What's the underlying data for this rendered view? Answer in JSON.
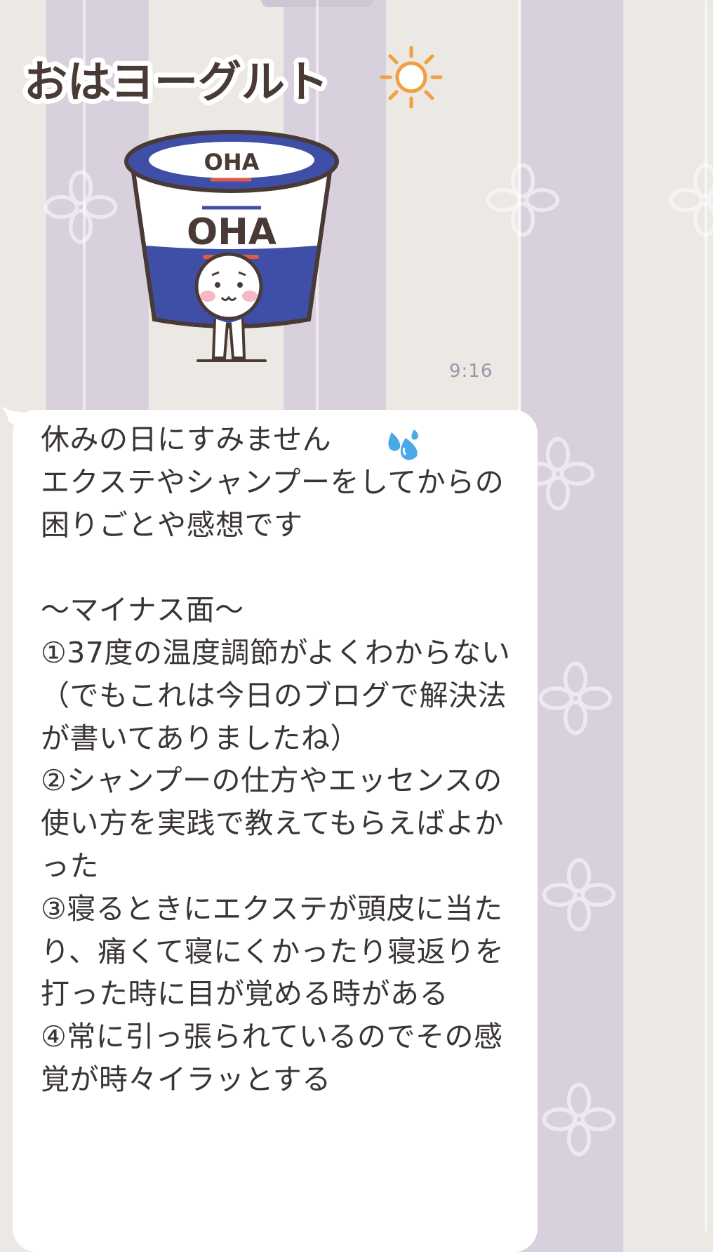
{
  "chat": {
    "sticker": {
      "title_text": "おはヨーグルト",
      "cup_lid_text": "OHA",
      "cup_label_text": "OHA"
    },
    "sticker_timestamp": "9:16",
    "message": {
      "text": "休みの日にすみません\nエクステやシャンプーをしてからの困りごとや感想です\n\n〜マイナス面〜\n①37度の温度調節がよくわからない（でもこれは今日のブログで解決法が書いてありましたね）\n②シャンプーの仕方やエッセンスの使い方を実践で教えてもらえばよかった\n③寝るときにエクステが頭皮に当たり、痛くて寝にくかったり寝返りを打った時に目が覚める時がある\n④常に引っ張られているのでその感覚が時々イラッとする",
      "emoji": "sweat-droplets-emoji"
    }
  },
  "colors": {
    "stripe_light": "#ece8e4",
    "stripe_purple": "#d9d0dd",
    "bubble": "#ffffff",
    "text": "#3a3438",
    "timestamp": "#9e93a9",
    "cup_blue": "#3f4fa8"
  }
}
